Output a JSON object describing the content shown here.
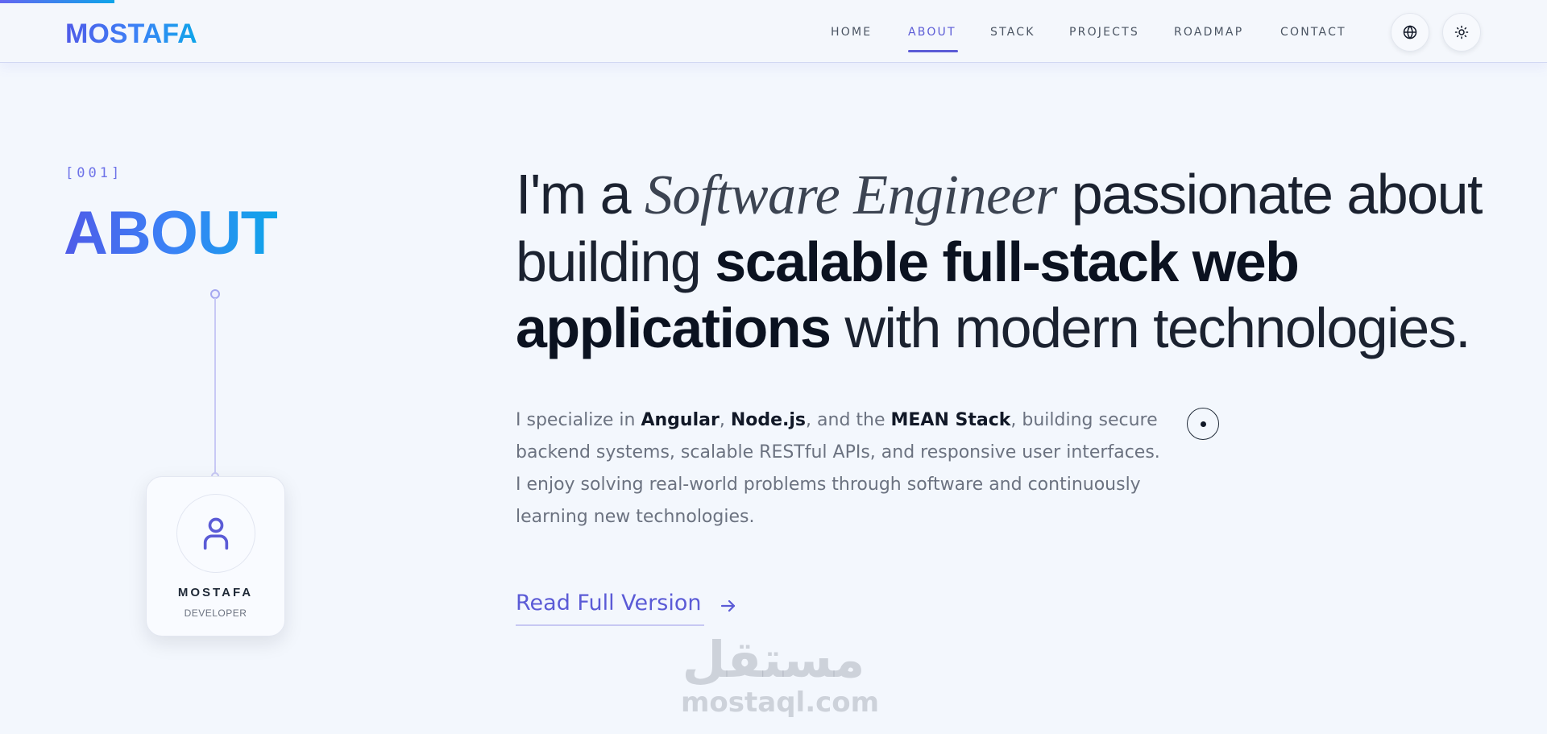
{
  "header": {
    "logo": "MOSTAFA",
    "nav": [
      {
        "label": "HOME"
      },
      {
        "label": "ABOUT"
      },
      {
        "label": "STACK"
      },
      {
        "label": "PROJECTS"
      },
      {
        "label": "ROADMAP"
      },
      {
        "label": "CONTACT"
      }
    ],
    "active_nav": "ABOUT",
    "icons": [
      "globe-icon",
      "sun-icon"
    ]
  },
  "section": {
    "index": "[001]",
    "title": "ABOUT"
  },
  "profile": {
    "name": "MOSTAFA",
    "role": "DEVELOPER",
    "icon": "user-icon"
  },
  "headline": {
    "part1": "I'm a ",
    "italic": "Software Engineer",
    "part2": " passionate about building ",
    "bold": "scalable full-stack web applications",
    "part3": " with modern technologies."
  },
  "body": {
    "t1": "I specialize in ",
    "b1": "Angular",
    "t2": ", ",
    "b2": "Node.js",
    "t3": ", and the ",
    "b3": "MEAN Stack",
    "t4": ", building secure backend systems, scalable RESTful APIs, and responsive user interfaces. I enjoy solving real-world problems through software and continuously learning new technologies."
  },
  "cta": {
    "label": "Read Full Version",
    "icon": "arrow-right-icon"
  },
  "watermark": {
    "arabic": "مستقل",
    "latin": "mostaql.com"
  },
  "colors": {
    "accent": "#5b5bd6",
    "gradient_start": "#4f5be8",
    "gradient_end": "#0ea5e9",
    "background": "#f3f7fd"
  }
}
